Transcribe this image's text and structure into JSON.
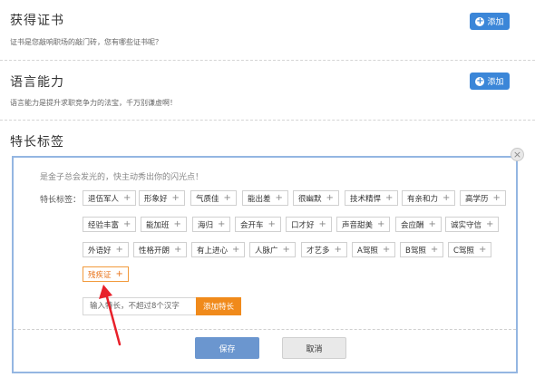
{
  "certificates": {
    "title": "获得证书",
    "description": "证书是您敲响职场的敲门砖，您有哪些证书呢？",
    "add_label": "添加"
  },
  "languages": {
    "title": "语言能力",
    "description": "语言能力是提升求职竞争力的法宝，千万别谦虚啊！",
    "add_label": "添加"
  },
  "skills": {
    "title": "特长标签",
    "hint": "是金子总会发光的，快主动秀出你的闪光点！",
    "tags_label": "特长标签：",
    "tag_plus": "+",
    "tags": [
      {
        "label": "退伍军人",
        "selected": false
      },
      {
        "label": "形象好",
        "selected": false
      },
      {
        "label": "气质佳",
        "selected": false
      },
      {
        "label": "能出差",
        "selected": false
      },
      {
        "label": "很幽默",
        "selected": false
      },
      {
        "label": "技术精悍",
        "selected": false
      },
      {
        "label": "有亲和力",
        "selected": false
      },
      {
        "label": "高学历",
        "selected": false
      },
      {
        "label": "经验丰富",
        "selected": false
      },
      {
        "label": "能加班",
        "selected": false
      },
      {
        "label": "海归",
        "selected": false
      },
      {
        "label": "会开车",
        "selected": false
      },
      {
        "label": "口才好",
        "selected": false
      },
      {
        "label": "声音甜美",
        "selected": false
      },
      {
        "label": "会应酬",
        "selected": false
      },
      {
        "label": "诚实守信",
        "selected": false
      },
      {
        "label": "外语好",
        "selected": false
      },
      {
        "label": "性格开朗",
        "selected": false
      },
      {
        "label": "有上进心",
        "selected": false
      },
      {
        "label": "人脉广",
        "selected": false
      },
      {
        "label": "才艺多",
        "selected": false
      },
      {
        "label": "A驾照",
        "selected": false
      },
      {
        "label": "B驾照",
        "selected": false
      },
      {
        "label": "C驾照",
        "selected": false
      },
      {
        "label": "残疾证",
        "selected": true
      }
    ],
    "input_placeholder": "输入特长，不超过8个汉字",
    "add_tag_label": "添加特长",
    "save_label": "保存",
    "cancel_label": "取消",
    "close_label": "×"
  },
  "colors": {
    "primary": "#3b86d8",
    "accent": "#f08a1b",
    "annotation": "#e8202a"
  },
  "icons": {
    "add": "plus-circle-icon",
    "close": "close-icon",
    "annotation": "red-arrow-icon"
  }
}
